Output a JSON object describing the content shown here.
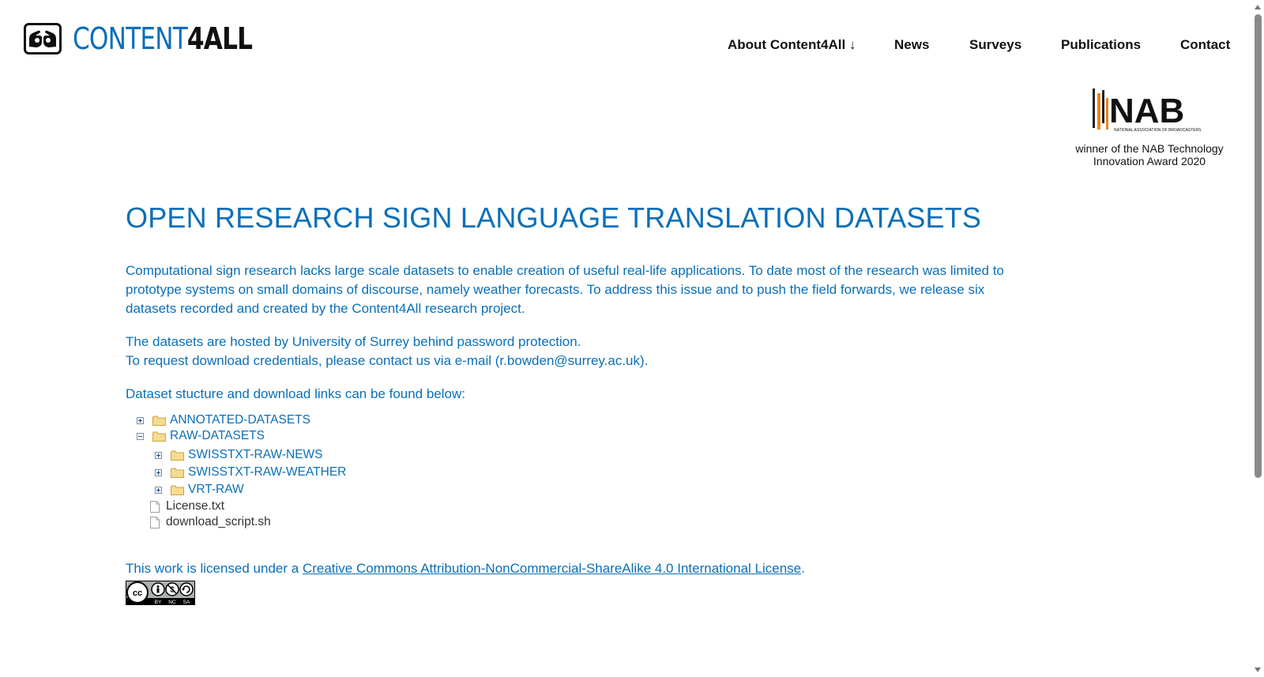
{
  "header": {
    "logo_text_light": "CONTENT",
    "logo_text_bold": "4ALL",
    "logo_icon": "signing-hands-icon"
  },
  "nav": {
    "items": [
      {
        "label": "About Content4All ↓"
      },
      {
        "label": "News"
      },
      {
        "label": "Surveys"
      },
      {
        "label": "Publications"
      },
      {
        "label": "Contact"
      }
    ]
  },
  "award": {
    "logo_text": "NAB",
    "logo_subtext": "NATIONAL ASSOCIATION OF BROADCASTERS",
    "caption_line1": "winner of the NAB Technology",
    "caption_line2": "Innovation Award 2020"
  },
  "main": {
    "title": "OPEN RESEARCH SIGN LANGUAGE TRANSLATION DATASETS",
    "intro": "Computational sign research lacks large scale datasets to enable creation of useful real-life applications. To date most of the research was limited to prototype systems on small domains of discourse, namely weather forecasts. To address this issue and to push the field forwards, we release six datasets recorded and created by the Content4All research project.",
    "hosting_line1": "The datasets are hosted by University of Surrey behind password protection.",
    "hosting_line2": "To request download credentials, please contact us via e-mail (r.bowden@surrey.ac.uk).",
    "structure_intro": "Dataset stucture and download links can be found below:"
  },
  "tree": {
    "annotated": "ANNOTATED-DATASETS",
    "raw": "RAW-DATASETS",
    "raw_news": "SWISSTXT-RAW-NEWS",
    "raw_weather": "SWISSTXT-RAW-WEATHER",
    "vrt_raw": "VRT-RAW",
    "license_file": "License.txt",
    "script_file": "download_script.sh"
  },
  "license": {
    "prefix": "This work is licensed under a ",
    "link_text": "Creative Commons Attribution-NonCommercial-ShareAlike 4.0 International License",
    "suffix": ".",
    "badge_labels": [
      "BY",
      "NC",
      "SA"
    ]
  },
  "colors": {
    "brand_blue": "#0a6fb8",
    "nab_orange": "#f0821e"
  }
}
